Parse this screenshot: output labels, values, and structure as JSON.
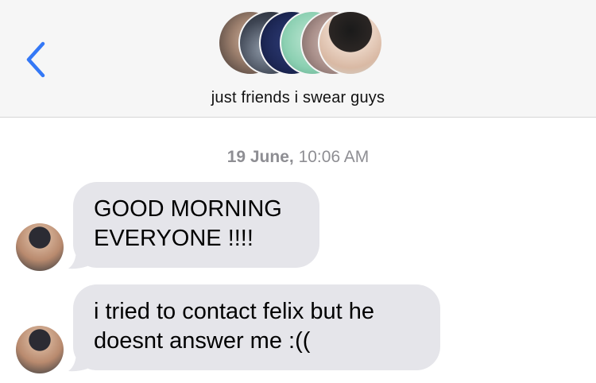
{
  "header": {
    "group_name": "just friends i swear guys",
    "member_avatar_count": 6
  },
  "conversation": {
    "timestamp_day": "19 June,",
    "timestamp_time": "10:06 AM",
    "messages": [
      {
        "text_line1": "GOOD MORNING",
        "text_line2": "EVERYONE !!!!"
      },
      {
        "text_line1": "i tried to contact felix but he",
        "text_line2": "doesnt answer me :(("
      }
    ]
  },
  "colors": {
    "accent": "#3478f6",
    "bubble_incoming": "#e5e5ea",
    "header_bg": "#f6f6f6",
    "timestamp": "#8e8e93"
  }
}
